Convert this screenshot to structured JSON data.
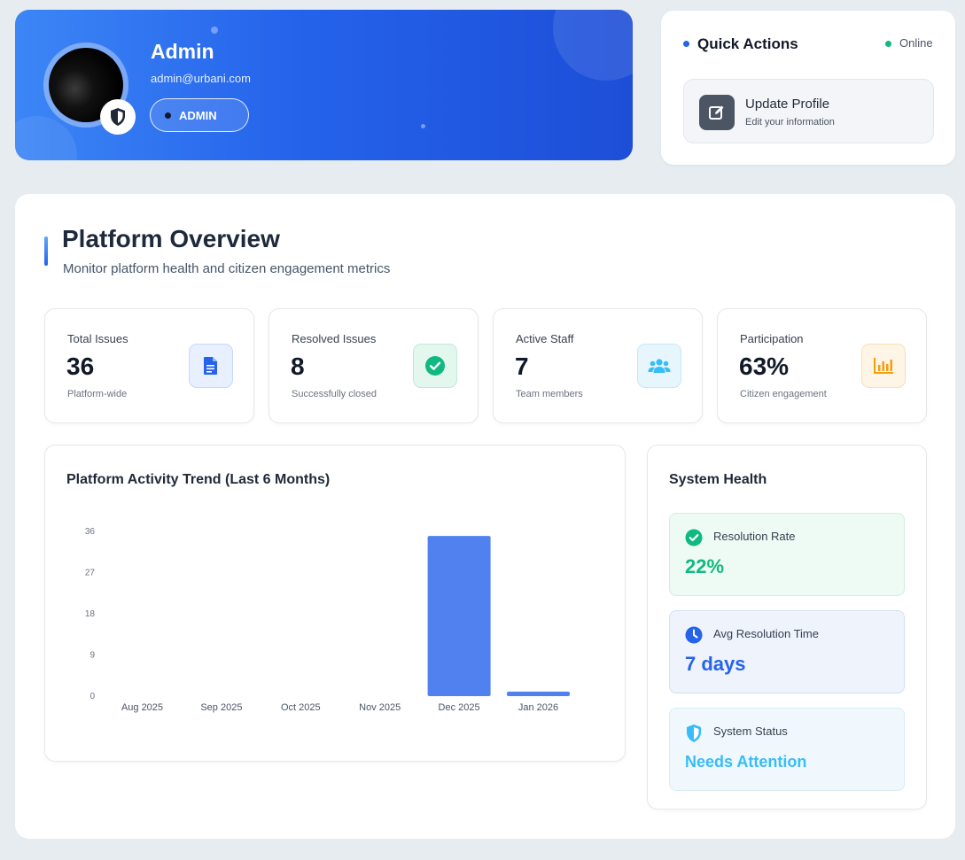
{
  "profile": {
    "name": "Admin",
    "email": "admin@urbani.com",
    "role": "ADMIN"
  },
  "quick_actions": {
    "title": "Quick Actions",
    "status": "Online",
    "update_profile": {
      "label": "Update Profile",
      "sub": "Edit your information"
    }
  },
  "overview": {
    "title": "Platform Overview",
    "subtitle": "Monitor platform health and citizen engagement metrics"
  },
  "stats": [
    {
      "label": "Total Issues",
      "value": "36",
      "sub": "Platform-wide",
      "icon": "document-icon",
      "color": "#2563eb"
    },
    {
      "label": "Resolved Issues",
      "value": "8",
      "sub": "Successfully closed",
      "icon": "check-circle-icon",
      "color": "#10b981"
    },
    {
      "label": "Active Staff",
      "value": "7",
      "sub": "Team members",
      "icon": "users-icon",
      "color": "#38bdf8"
    },
    {
      "label": "Participation",
      "value": "63%",
      "sub": "Citizen engagement",
      "icon": "bar-chart-icon",
      "color": "#f59e0b"
    }
  ],
  "chart_data": {
    "type": "bar",
    "title": "Platform Activity Trend (Last 6 Months)",
    "categories": [
      "Aug 2025",
      "Sep 2025",
      "Oct 2025",
      "Nov 2025",
      "Dec 2025",
      "Jan 2026"
    ],
    "values": [
      0,
      0,
      0,
      0,
      35,
      1
    ],
    "yticks": [
      "0",
      "9",
      "18",
      "27",
      "36"
    ],
    "ylim": [
      0,
      36
    ],
    "color": "#5081ee"
  },
  "health": {
    "title": "System Health",
    "items": [
      {
        "label": "Resolution Rate",
        "value": "22%",
        "icon": "check-circle-icon",
        "color": "#10b981"
      },
      {
        "label": "Avg Resolution Time",
        "value": "7 days",
        "icon": "clock-icon",
        "color": "#2563eb"
      },
      {
        "label": "System Status",
        "value": "Needs Attention",
        "icon": "shield-icon",
        "color": "#38bdf8"
      }
    ]
  }
}
